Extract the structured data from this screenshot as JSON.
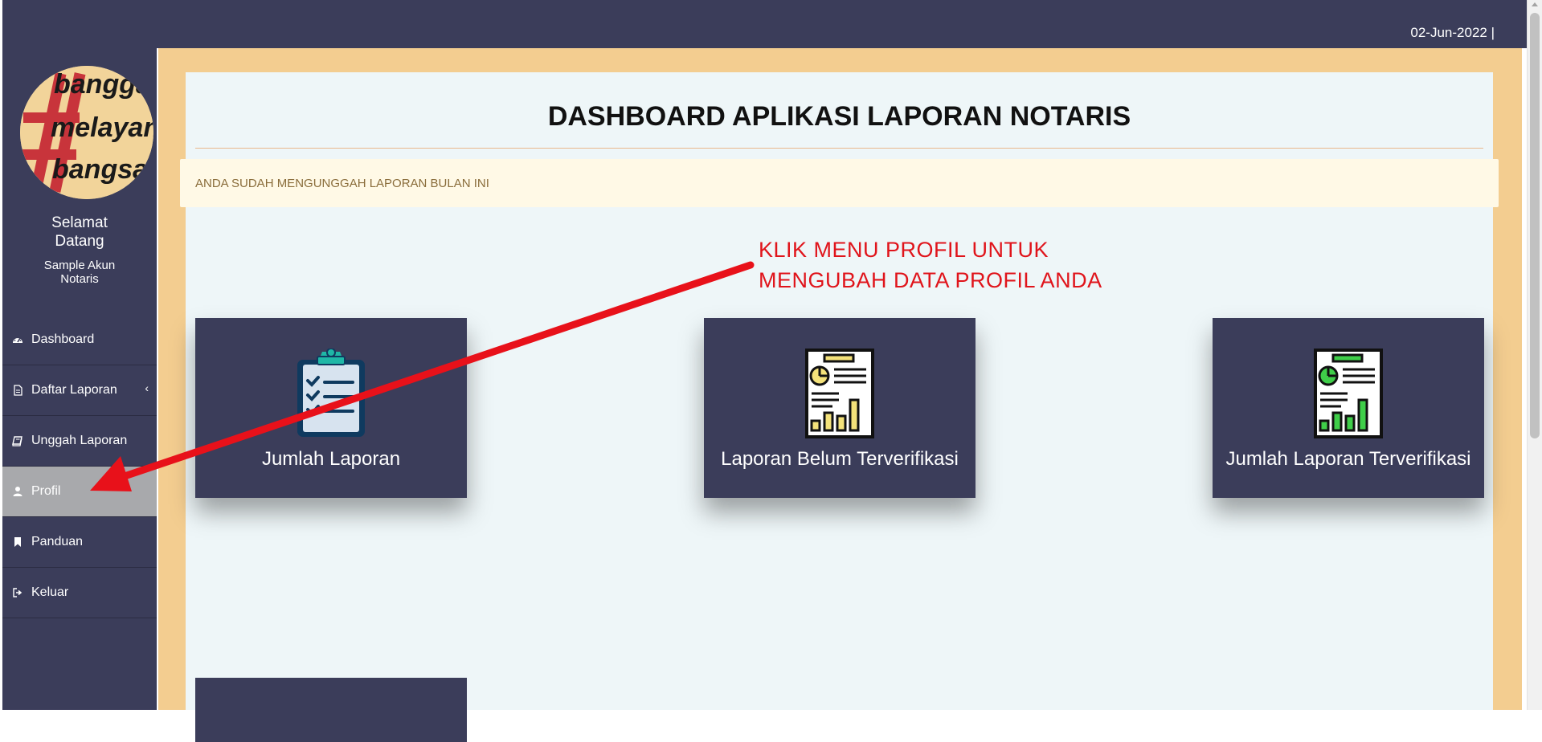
{
  "header": {
    "date": "02-Jun-2022 |"
  },
  "sidebar": {
    "logo_text": [
      "bangga",
      "melayani",
      "bangsa"
    ],
    "welcome": "Selamat Datang",
    "account": "Sample Akun Notaris",
    "items": [
      {
        "label": "Dashboard",
        "icon": "dashboard-icon"
      },
      {
        "label": "Daftar Laporan",
        "icon": "file-icon",
        "has_submenu": true,
        "chevron": "‹"
      },
      {
        "label": "Unggah Laporan",
        "icon": "book-icon"
      },
      {
        "label": "Profil",
        "icon": "user-icon",
        "active": true
      },
      {
        "label": "Panduan",
        "icon": "bookmark-icon"
      },
      {
        "label": "Keluar",
        "icon": "sign-out-icon"
      }
    ]
  },
  "main": {
    "title": "DASHBOARD APLIKASI LAPORAN NOTARIS",
    "alert": "ANDA SUDAH MENGUNGGAH LAPORAN BULAN INI",
    "annotation": [
      "KLIK MENU PROFIL UNTUK",
      "MENGUBAH DATA PROFIL ANDA"
    ],
    "cards": [
      {
        "label": "Jumlah Laporan",
        "icon": "clipboard-checklist-icon"
      },
      {
        "label": "Laporan Belum Terverifikasi",
        "icon": "report-chart-yellow-icon"
      },
      {
        "label": "Jumlah Laporan Terverifikasi",
        "icon": "report-chart-green-icon"
      }
    ]
  },
  "colors": {
    "sidebar_bg": "#3b3d5a",
    "content_bg": "#f3cd90",
    "panel_bg": "#eef6f8",
    "alert_bg": "#fff9e6",
    "alert_text": "#8a6d3b",
    "annotation": "#e0141b",
    "active_item": "#a8a9ac"
  }
}
